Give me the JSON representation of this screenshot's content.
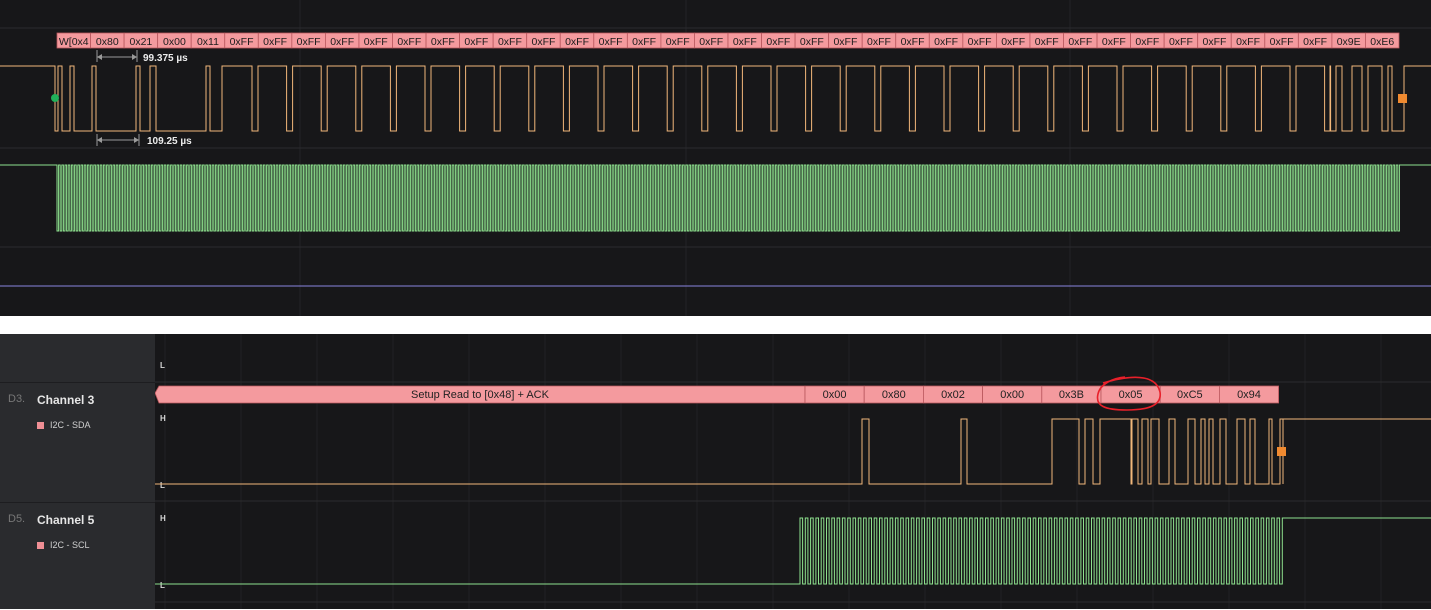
{
  "colors": {
    "background": "#171719",
    "sidebar": "#2a2b2e",
    "sda_trace": "#f2b77a",
    "scl_trace": "#8ee28e",
    "decode_fill": "#f49a9e",
    "marker_orange": "#f08a30",
    "marker_green": "#21b05a",
    "annotation_red": "#e8202a",
    "flat_trace": "#8a84e0"
  },
  "top_view": {
    "decode_labels": [
      "W[0x4",
      "0x80",
      "0x21",
      "0x00",
      "0x11",
      "0xFF",
      "0xFF",
      "0xFF",
      "0xFF",
      "0xFF",
      "0xFF",
      "0xFF",
      "0xFF",
      "0xFF",
      "0xFF",
      "0xFF",
      "0xFF",
      "0xFF",
      "0xFF",
      "0xFF",
      "0xFF",
      "0xFF",
      "0xFF",
      "0xFF",
      "0xFF",
      "0xFF",
      "0xFF",
      "0xFF",
      "0xFF",
      "0xFF",
      "0xFF",
      "0xFF",
      "0xFF",
      "0xFF",
      "0xFF",
      "0xFF",
      "0xFF",
      "0xFF",
      "0x9E",
      "0xE6"
    ],
    "measure_top": "99.375 µs",
    "measure_bottom": "109.25 µs"
  },
  "bottom_view": {
    "top_level_label": "L",
    "channels": [
      {
        "tag": "D3.",
        "name": "Channel 3",
        "analyzer": "I2C - SDA",
        "high_label": "H",
        "low_label": "L"
      },
      {
        "tag": "D5.",
        "name": "Channel 5",
        "analyzer": "I2C - SCL",
        "high_label": "H",
        "low_label": "L"
      }
    ],
    "decode": {
      "setup_label": "Setup Read to [0x48] + ACK",
      "bytes": [
        "0x00",
        "0x80",
        "0x02",
        "0x00",
        "0x3B",
        "0x05",
        "0xC5",
        "0x94"
      ],
      "circled_byte_index": 5
    }
  }
}
